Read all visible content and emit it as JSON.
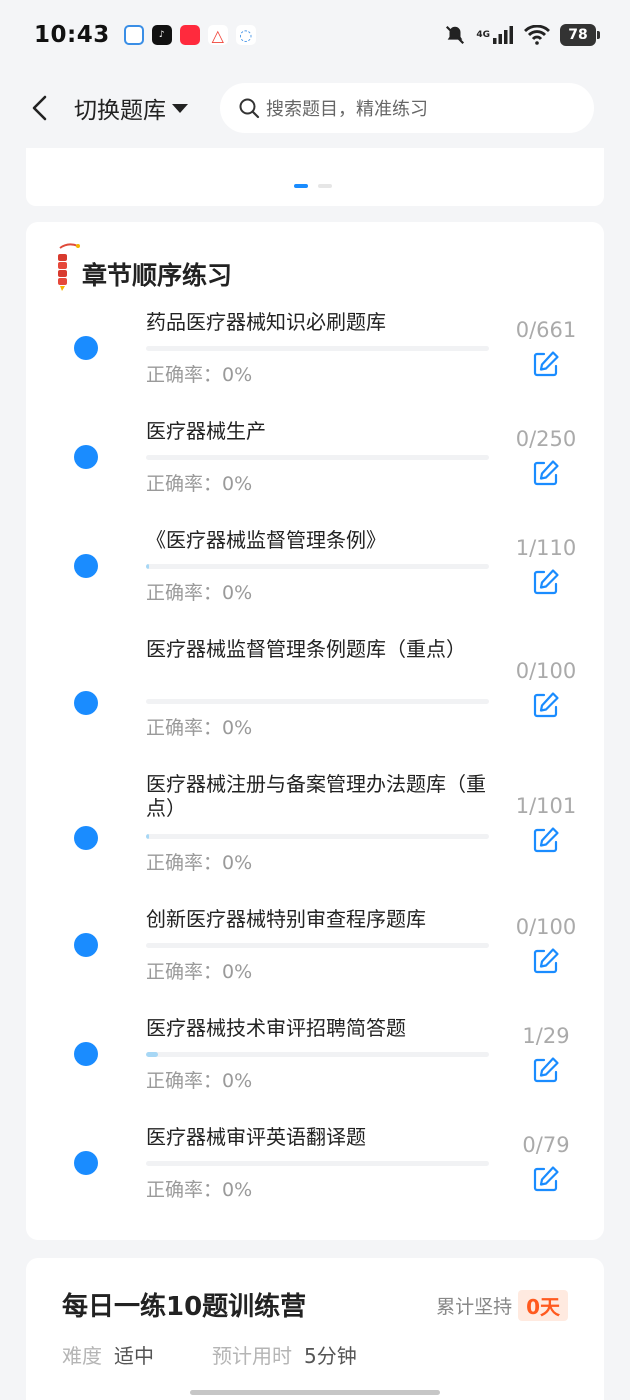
{
  "status_bar": {
    "time": "10:43",
    "network": "4G",
    "battery": "78"
  },
  "nav": {
    "switch_label": "切换题库",
    "search_placeholder": "搜索题目，精准练习"
  },
  "chapter_section": {
    "title": "章节顺序练习",
    "items": [
      {
        "title": "药品医疗器械知识必刷题库",
        "count": "0/661",
        "accuracy_label": "正确率：",
        "accuracy": "0%",
        "progress": 0
      },
      {
        "title": "医疗器械生产",
        "count": "0/250",
        "accuracy_label": "正确率：",
        "accuracy": "0%",
        "progress": 0
      },
      {
        "title": "《医疗器械监督管理条例》",
        "count": "1/110",
        "accuracy_label": "正确率：",
        "accuracy": "0%",
        "progress": 0.009
      },
      {
        "title": "医疗器械监督管理条例题库（重点）",
        "count": "0/100",
        "accuracy_label": "正确率：",
        "accuracy": "0%",
        "progress": 0
      },
      {
        "title": "医疗器械注册与备案管理办法题库（重点）",
        "count": "1/101",
        "accuracy_label": "正确率：",
        "accuracy": "0%",
        "progress": 0.0099
      },
      {
        "title": "创新医疗器械特别审查程序题库",
        "count": "0/100",
        "accuracy_label": "正确率：",
        "accuracy": "0%",
        "progress": 0
      },
      {
        "title": "医疗器械技术审评招聘简答题",
        "count": "1/29",
        "accuracy_label": "正确率：",
        "accuracy": "0%",
        "progress": 0.034
      },
      {
        "title": "医疗器械审评英语翻译题",
        "count": "0/79",
        "accuracy_label": "正确率：",
        "accuracy": "0%",
        "progress": 0
      }
    ]
  },
  "daily": {
    "title": "每日一练10题训练营",
    "streak_label": "累计坚持",
    "streak_value": "0天",
    "difficulty_label": "难度",
    "difficulty_value": "适中",
    "time_label": "预计用时",
    "time_value": "5分钟"
  },
  "colors": {
    "accent": "#1a8cff",
    "progress_fill": "#a7d7f5",
    "streak": "#ff5a1f"
  }
}
